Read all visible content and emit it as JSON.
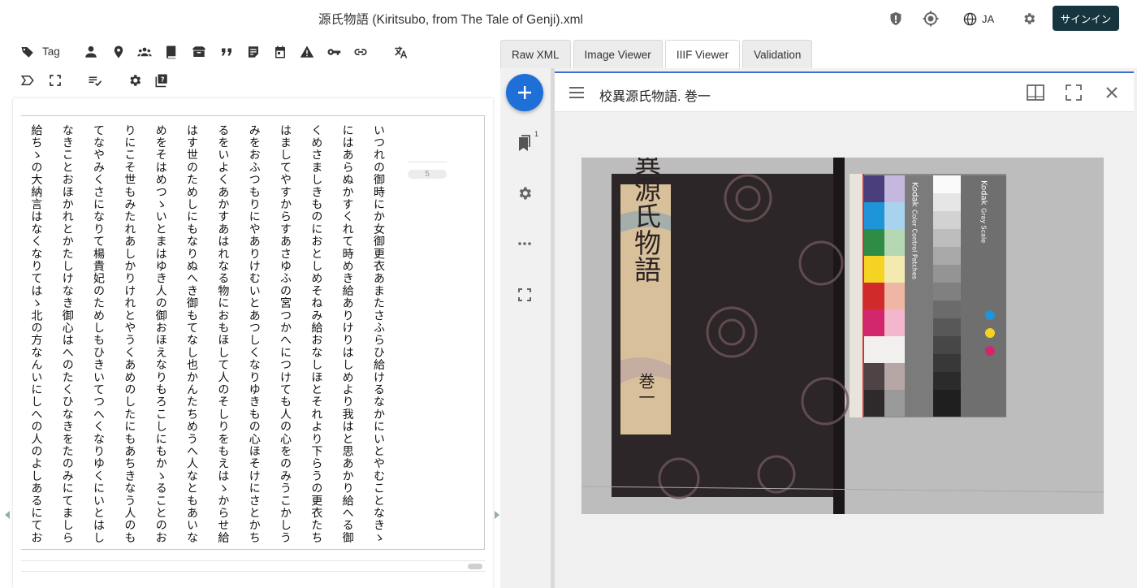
{
  "header": {
    "doc_title": "源氏物語 (Kiritsubo, from The Tale of Genji).xml",
    "language": "JA",
    "signin_label": "サインイン"
  },
  "toolbar": {
    "tag_label": "Tag",
    "icons": [
      "tag-icon",
      "person-icon",
      "place-icon",
      "group-icon",
      "book-icon",
      "box-icon",
      "quote-icon",
      "note-icon",
      "calendar-icon",
      "warning-icon",
      "key-icon",
      "link-icon",
      "translate-icon",
      "label-icon",
      "expand-icon",
      "checklist-icon",
      "settings-icon",
      "help-icon"
    ]
  },
  "editor": {
    "page_number": "5",
    "columns": [
      "いつれの御時にか女御更衣あまたさふらひ給けるなかにいとやむことなきゝは",
      "にはあらぬかすくれて時めき給ありけりはしめより我はと思あかり給へる御方",
      "くめさましきものにおとしめそねみ給おなしほとそれより下らうの更衣たち",
      "はましてやすからすあさゆふの宮つかへにつけても人の心をのみうこかしうら",
      "みをおふつもりにやありけむいとあつしくなりゆきもの心ほそけにさとかちな",
      "るをいよくあかすあはれなる物におもほして人のそしりをもえはゝからせ給",
      "はす世のためしにもなりぬへき御もてなし也かんたちめうへ人なともあいなく",
      "めをそはめつゝいとまはゆき人の御おほえなりもろこしにもかゝることのおこ",
      "りにこそ世もみたれあしかりけれとやうくあめのしたにもあちきなう人のも",
      "てなやみくさになりて楊貴妃のためしもひきいてつへくなりゆくにいとはした",
      "なきことおほかれとかたしけなき御心はへのたくひなきをたのみにてましらひ",
      "給ちゝの大納言はなくなりてはゝ北の方なんいにしへの人のよしあるにておや"
    ]
  },
  "tabs": [
    {
      "label": "Raw XML",
      "active": false
    },
    {
      "label": "Image Viewer",
      "active": false
    },
    {
      "label": "IIIF Viewer",
      "active": true
    },
    {
      "label": "Validation",
      "active": false
    }
  ],
  "side_panel": {
    "bookmark_count": "1"
  },
  "viewer": {
    "title": "校異源氏物語. 巻一",
    "book_title": "校異源氏物語",
    "volume": "巻一",
    "card_brand": "Kodak",
    "card_title": "Color Control Patches",
    "grayscale_label": "Gray Scale",
    "colors": {
      "accent": "#1f6fd8",
      "signin_bg": "#17353f"
    }
  }
}
